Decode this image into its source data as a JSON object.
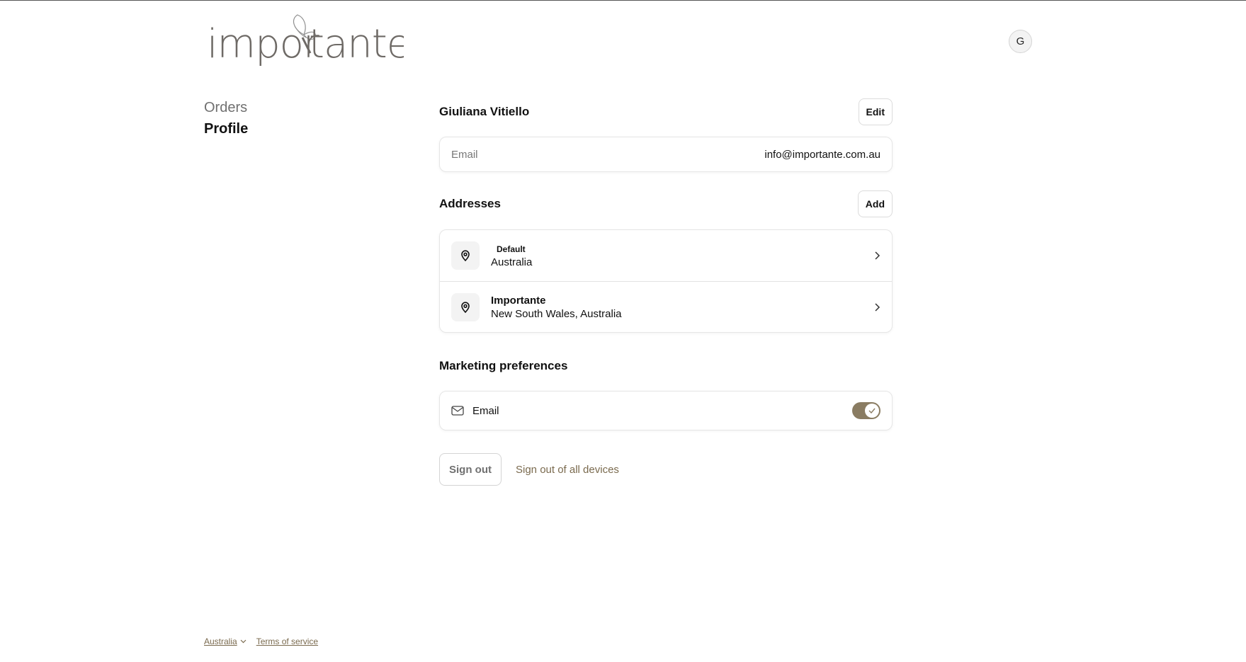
{
  "header": {
    "logo_text": "importante",
    "avatar_initial": "G"
  },
  "nav": {
    "items": [
      {
        "label": "Orders"
      },
      {
        "label": "Profile"
      }
    ]
  },
  "profile": {
    "name": "Giuliana Vitiello",
    "edit_label": "Edit",
    "email_label": "Email",
    "email_value": "info@importante.com.au"
  },
  "addresses": {
    "title": "Addresses",
    "add_label": "Add",
    "items": [
      {
        "badge": "Default",
        "line": "Australia"
      },
      {
        "name": "Importante",
        "line": "New South Wales, Australia"
      }
    ]
  },
  "marketing": {
    "title": "Marketing preferences",
    "email_label": "Email",
    "email_enabled": true
  },
  "actions": {
    "signout_label": "Sign out",
    "signout_all_label": "Sign out of all devices"
  },
  "footer": {
    "country": "Australia",
    "terms": "Terms of service"
  },
  "colors": {
    "accent": "#8a7c62",
    "link": "#7a6a4e"
  }
}
